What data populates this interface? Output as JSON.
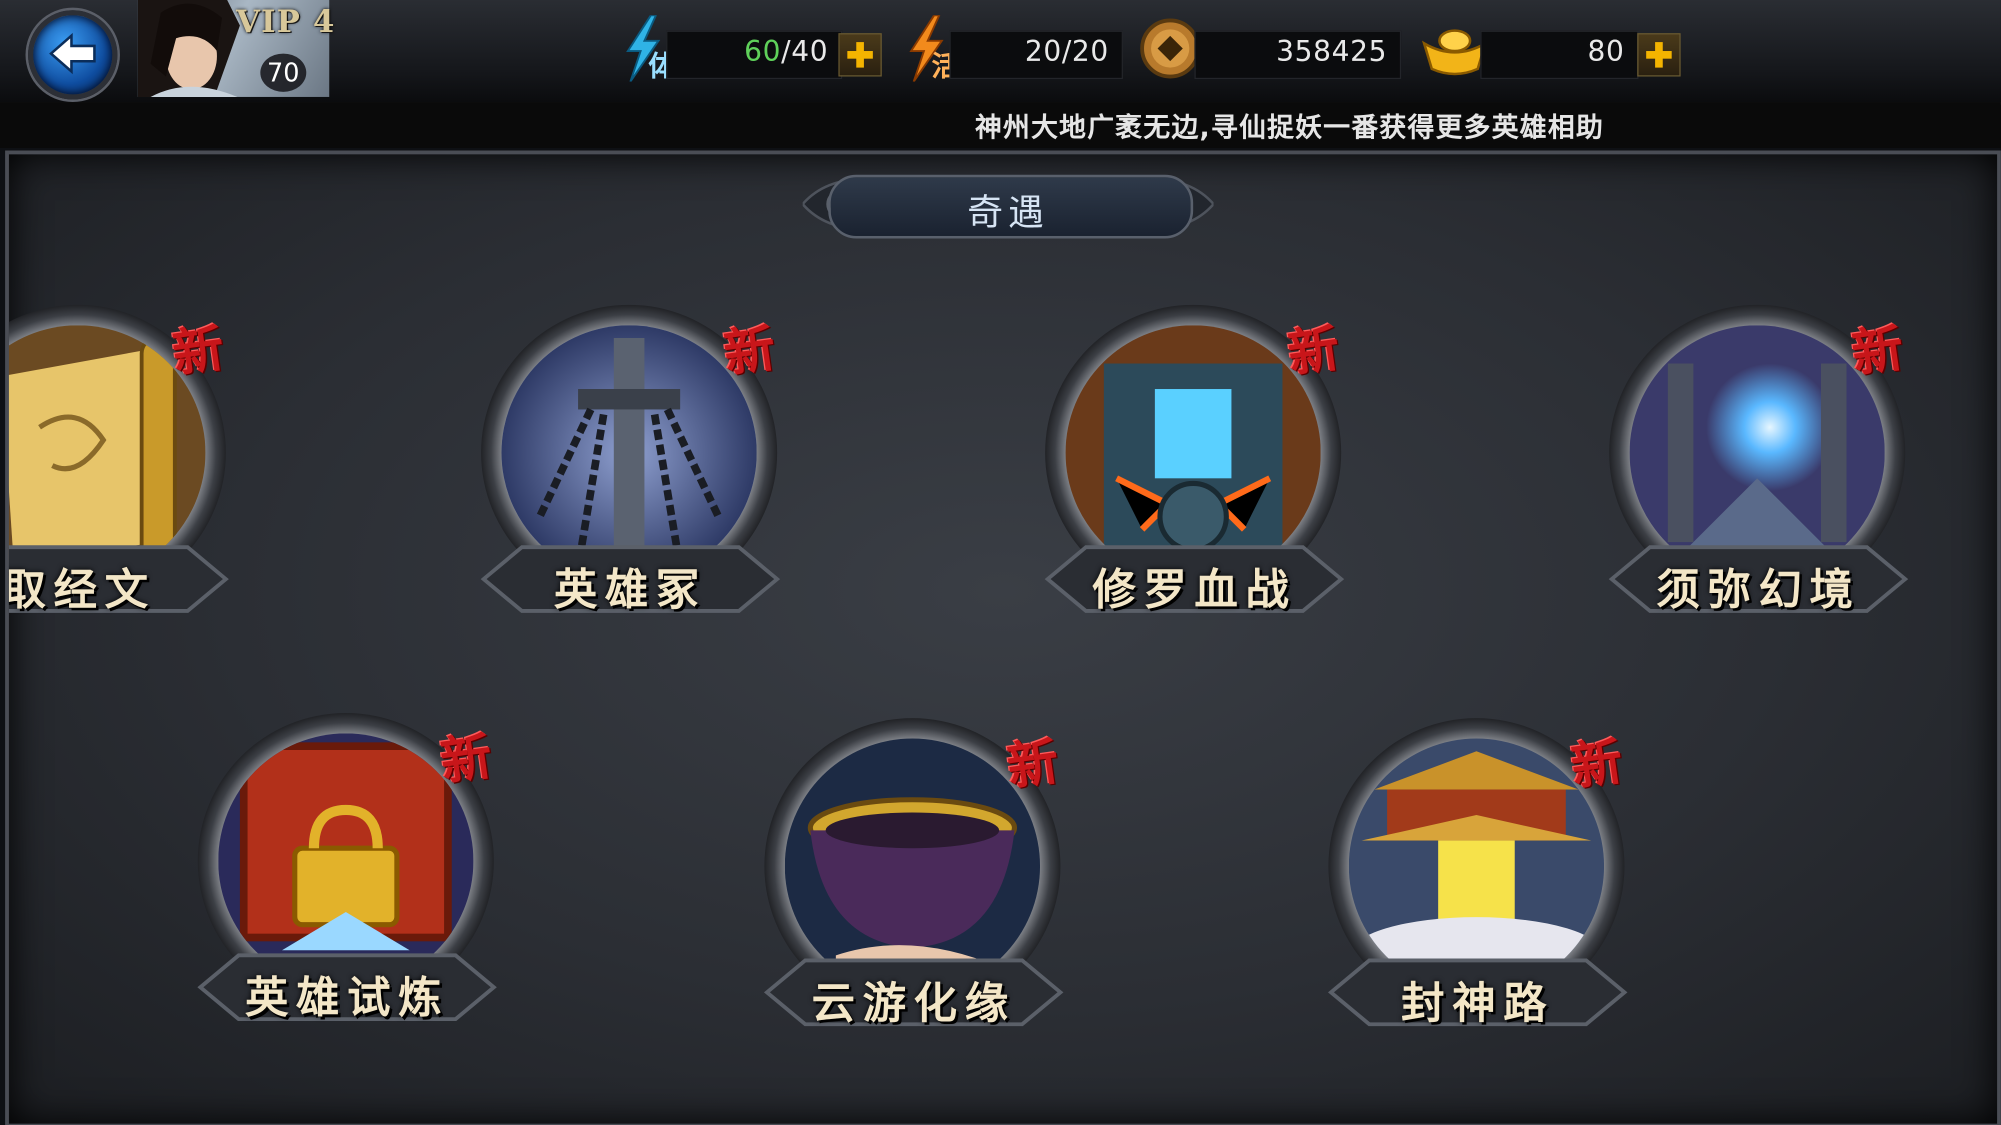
{
  "header": {
    "vip_label": "VIP 4",
    "level": "70",
    "stamina": {
      "glyph": "体",
      "current": "60",
      "max": "/40"
    },
    "vitality": {
      "glyph": "活",
      "value": "20/20"
    },
    "coins": "358425",
    "gold": "80"
  },
  "marquee": "神州大地广袤无边,寻仙捉妖一番获得更多英雄相助",
  "panel": {
    "title": "奇遇"
  },
  "events": [
    {
      "label": "取经文",
      "badge": "新"
    },
    {
      "label": "英雄冢",
      "badge": "新"
    },
    {
      "label": "修罗血战",
      "badge": "新"
    },
    {
      "label": "须弥幻境",
      "badge": "新"
    },
    {
      "label": "英雄试炼",
      "badge": "新"
    },
    {
      "label": "云游化缘",
      "badge": "新"
    },
    {
      "label": "封神路",
      "badge": "新"
    }
  ],
  "colors": {
    "accent_gold": "#f4b400",
    "badge_red": "#c8161a",
    "stamina_green": "#5fd05a"
  }
}
